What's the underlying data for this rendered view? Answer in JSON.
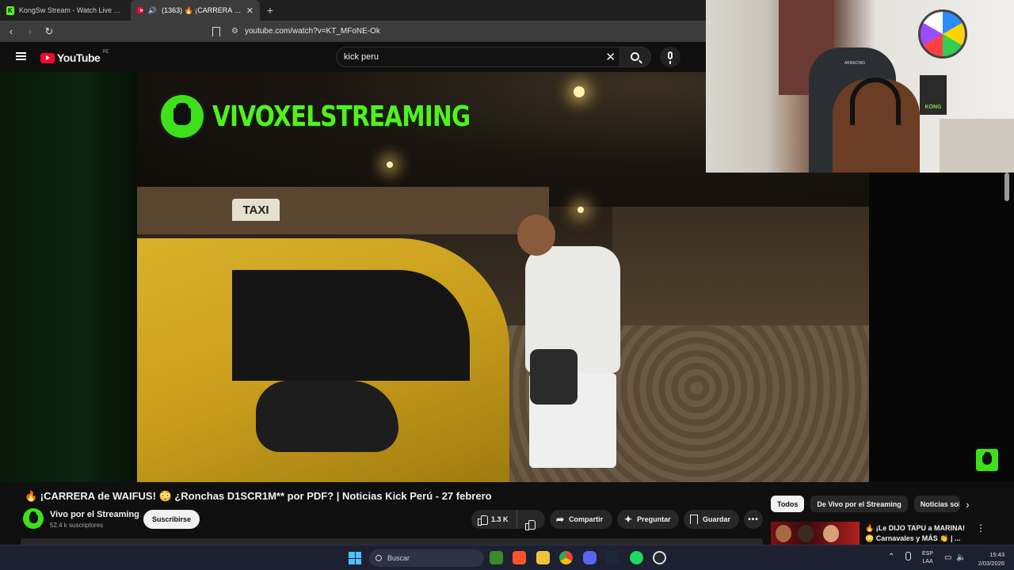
{
  "browser": {
    "tabs": [
      {
        "title": "KongSw Stream - Watch Live on Kick",
        "favicon": "kick-favicon",
        "active": false
      },
      {
        "title": "(1363) 🔥 ¡CARRERA de WAIFUS!",
        "favicon": "youtube-favicon",
        "active": true,
        "audio": "🔊"
      }
    ],
    "new_tab": "+",
    "close_glyph": "✕",
    "url": "youtube.com/watch?v=KT_MFoNE-Ok"
  },
  "youtube": {
    "logo_text": "YouTube",
    "country_code": "PE",
    "search_value": "kick peru",
    "clear_glyph": "✕"
  },
  "video": {
    "overlay_brand": "VIVOXELSTREAMING",
    "taxi_sign": "TAXI",
    "title": "🔥 ¡CARRERA de WAIFUS! 😳 ¿Ronchas D1SCR1M** por PDF? | Noticias Kick Perú - 27 febrero",
    "channel_name": "Vivo por el Streaming",
    "subscribers": "52.4 k suscriptores",
    "subscribe_label": "Suscribirse",
    "likes": "1.3 K",
    "share_label": "Compartir",
    "ask_label": "Preguntar",
    "save_label": "Guardar",
    "more_glyph": "•••"
  },
  "webcam": {
    "chair_brand": "AKRACING",
    "figure_text": "KONG"
  },
  "sidebar": {
    "chips": [
      "Todos",
      "De Vivo por el Streaming",
      "Noticias sob"
    ],
    "next_glyph": "›",
    "recommendation_title": "🔥 ¡Le DIJO TAPU a MARINA! 😳 Carnavales y MÁS 👏 | ..."
  },
  "taskbar": {
    "search_label": "Buscar",
    "lang_top": "ESP",
    "lang_bottom": "LAA",
    "time": "15:43",
    "date": "2/03/2026",
    "accent": "#4cc2ff"
  },
  "colors": {
    "kick_green": "#53fc18",
    "youtube_red": "#ff0033",
    "channel_green": "#3ee01a"
  }
}
